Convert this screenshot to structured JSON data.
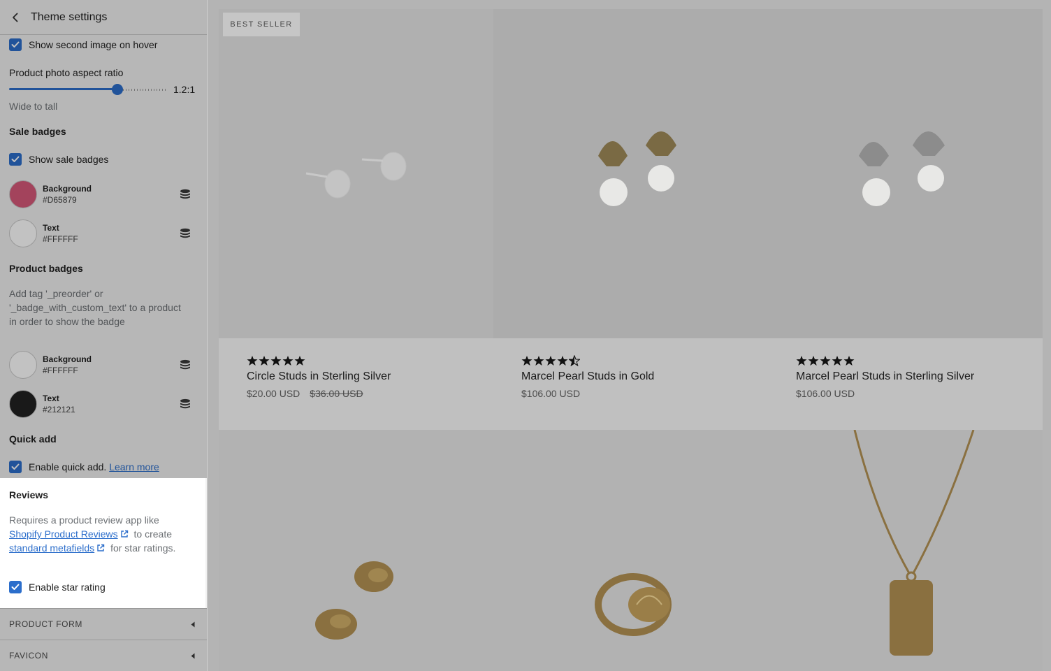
{
  "header": {
    "title": "Theme settings"
  },
  "settings": {
    "show_second_image": "Show second image on hover",
    "aspect_ratio_label": "Product photo aspect ratio",
    "aspect_ratio_value": "1.2:1",
    "aspect_ratio_fraction": 0.69,
    "aspect_ratio_help": "Wide to tall",
    "sale_badges_title": "Sale badges",
    "show_sale_badges": "Show sale badges",
    "sale_bg_label": "Background",
    "sale_bg_value": "#D65879",
    "sale_text_label": "Text",
    "sale_text_value": "#FFFFFF",
    "product_badges_title": "Product badges",
    "product_badges_help_1": "Add tag '_preorder' or",
    "product_badges_help_2": "'_badge_with_custom_text' to a product",
    "product_badges_help_3": "in order to show the badge",
    "prod_bg_label": "Background",
    "prod_bg_value": "#FFFFFF",
    "prod_text_label": "Text",
    "prod_text_value": "#212121",
    "quick_add_title": "Quick add",
    "quick_add_label": "Enable quick add.",
    "quick_add_link": "Learn more",
    "reviews_title": "Reviews",
    "reviews_help_1": "Requires a product review app like",
    "reviews_link_1": "Shopify Product Reviews",
    "reviews_help_2": "to create",
    "reviews_link_2": "standard metafields",
    "reviews_help_3": "for star ratings.",
    "star_rating_label": "Enable star rating"
  },
  "sections": {
    "product_form": "PRODUCT FORM",
    "favicon": "FAVICON"
  },
  "products": [
    {
      "badge": "BEST SELLER",
      "title": "Circle Studs in Sterling Silver",
      "price": "$20.00 USD",
      "compare": "$36.00 USD",
      "rating": 5
    },
    {
      "badge": "",
      "title": "Marcel Pearl Studs in Gold",
      "price": "$106.00 USD",
      "compare": "",
      "rating": 4.5
    },
    {
      "badge": "",
      "title": "Marcel Pearl Studs in Sterling Silver",
      "price": "$106.00 USD",
      "compare": "",
      "rating": 5
    }
  ],
  "colors": {
    "accent": "#2c6ecb",
    "sale_bg": "#D65879",
    "sale_text": "#FFFFFF",
    "prod_bg": "#FFFFFF",
    "prod_text": "#212121"
  }
}
